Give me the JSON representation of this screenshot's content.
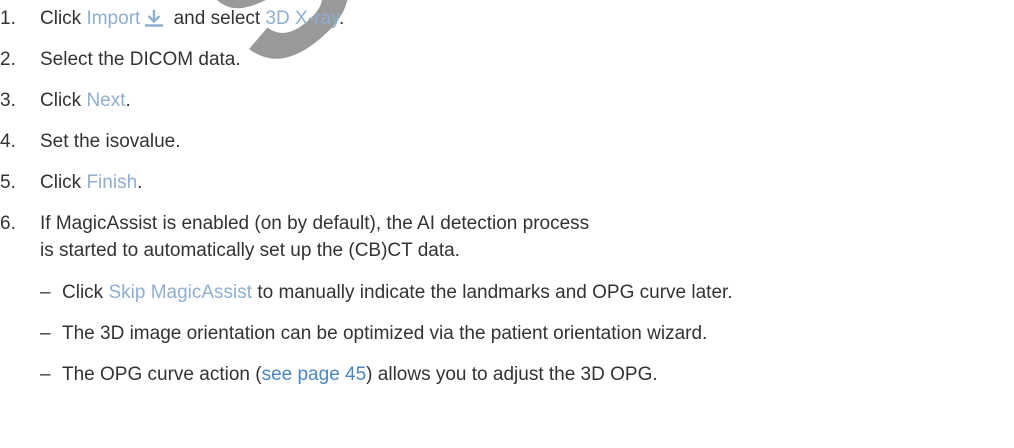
{
  "steps": [
    {
      "num": "1.",
      "pre": "Click ",
      "kw1": "Import",
      "icon": "download-icon",
      "mid": " and select ",
      "kw2": "3D X-ray",
      "post": "."
    },
    {
      "num": "2.",
      "text": "Select the DICOM data."
    },
    {
      "num": "3.",
      "pre": "Click ",
      "kw": "Next",
      "post": "."
    },
    {
      "num": "4.",
      "text": "Set the isovalue."
    },
    {
      "num": "5.",
      "pre": "Click ",
      "kw": "Finish",
      "post": "."
    },
    {
      "num": "6.",
      "line1": "If MagicAssist is enabled (on by default), the AI detection process",
      "line2": "is started to automatically set up the (CB)CT data."
    }
  ],
  "subitems": [
    {
      "dash": "–",
      "pre": "Click ",
      "kw": "Skip MagicAssist",
      "post": " to manually indicate the landmarks and OPG curve later."
    },
    {
      "dash": "–",
      "text": "The 3D image orientation can be optimized via the patient orientation wizard."
    },
    {
      "dash": "–",
      "pre": "The OPG curve action (",
      "link": "see page 45",
      "post": ") allows you to adjust the 3D OPG."
    }
  ],
  "colors": {
    "keyword": "#8fafd0",
    "link": "#4a86c0",
    "watermark": "#7f7f7f"
  },
  "watermark": {
    "text": "SU"
  }
}
